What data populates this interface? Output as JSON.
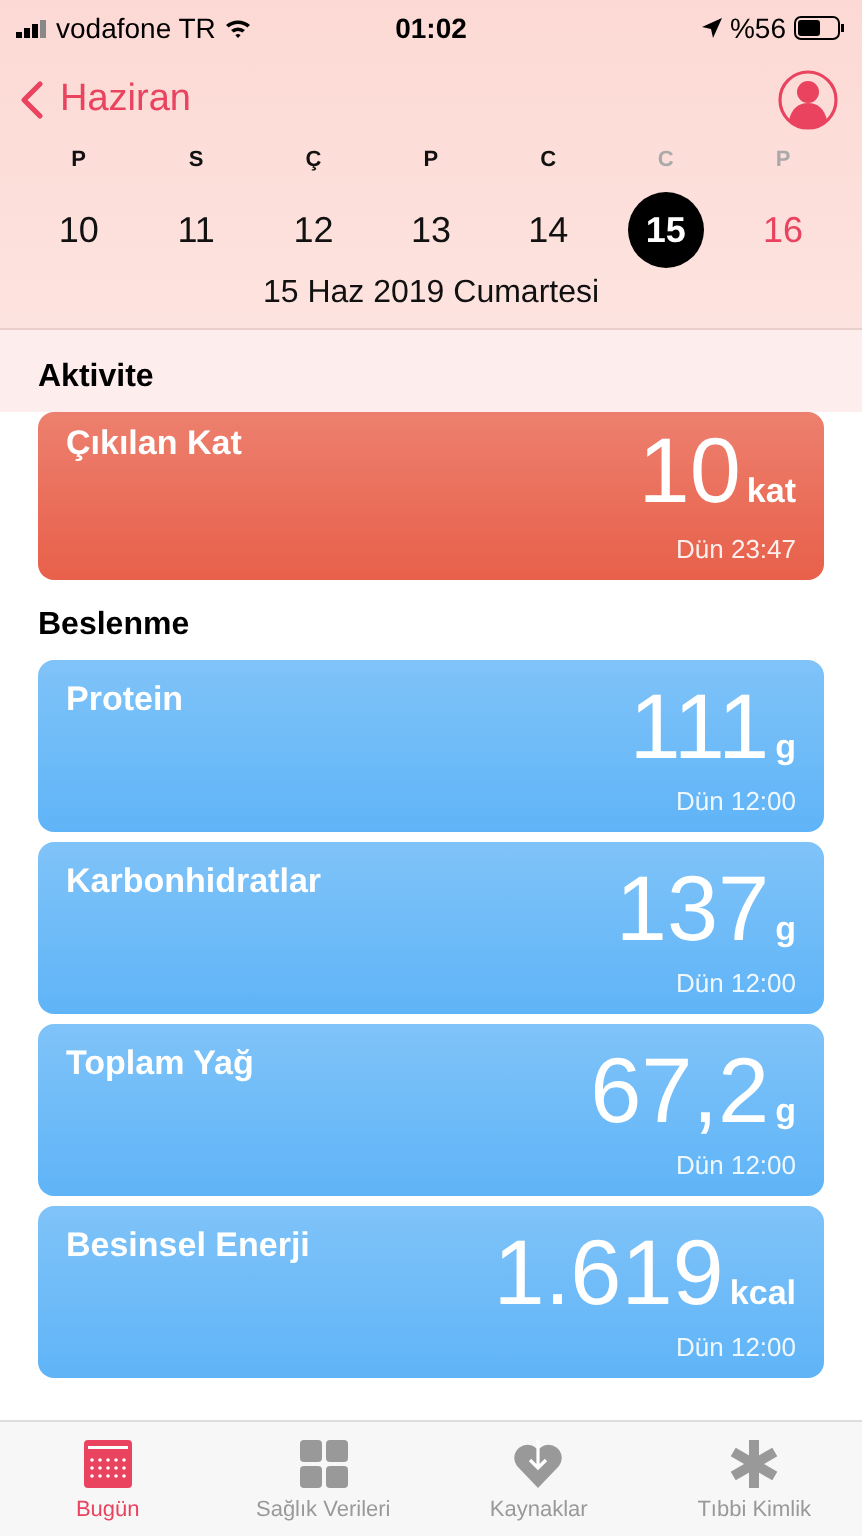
{
  "status_bar": {
    "carrier": "vodafone TR",
    "time": "01:02",
    "battery": "%56"
  },
  "nav": {
    "back": "Haziran"
  },
  "week": [
    {
      "letter": "P",
      "date": "10",
      "weekend": false,
      "today": false,
      "selected": false
    },
    {
      "letter": "S",
      "date": "11",
      "weekend": false,
      "today": false,
      "selected": false
    },
    {
      "letter": "Ç",
      "date": "12",
      "weekend": false,
      "today": false,
      "selected": false
    },
    {
      "letter": "P",
      "date": "13",
      "weekend": false,
      "today": false,
      "selected": false
    },
    {
      "letter": "C",
      "date": "14",
      "weekend": false,
      "today": false,
      "selected": false
    },
    {
      "letter": "C",
      "date": "15",
      "weekend": true,
      "today": false,
      "selected": true
    },
    {
      "letter": "P",
      "date": "16",
      "weekend": true,
      "today": true,
      "selected": false
    }
  ],
  "date_label": "15 Haz 2019 Cumartesi",
  "sections": [
    {
      "title": "Aktivite",
      "cards": [
        {
          "name": "Çıkılan Kat",
          "value": "10",
          "unit": "kat",
          "time": "Dün 23:47",
          "color": "#e8604a"
        }
      ]
    },
    {
      "title": "Beslenme",
      "cards": [
        {
          "name": "Protein",
          "value": "111",
          "unit": "g",
          "time": "Dün 12:00",
          "color": "#5fb4f7"
        },
        {
          "name": "Karbonhidratlar",
          "value": "137",
          "unit": "g",
          "time": "Dün 12:00",
          "color": "#5fb4f7"
        },
        {
          "name": "Toplam Yağ",
          "value": "67,2",
          "unit": "g",
          "time": "Dün 12:00",
          "color": "#5fb4f7"
        },
        {
          "name": "Besinsel Enerji",
          "value": "1.619",
          "unit": "kcal",
          "time": "Dün 12:00",
          "color": "#5fb4f7"
        }
      ]
    }
  ],
  "tabs": [
    {
      "label": "Bugün",
      "kind": "calendar",
      "selected": true
    },
    {
      "label": "Sağlık Verileri",
      "kind": "grid",
      "selected": false
    },
    {
      "label": "Kaynaklar",
      "kind": "heart",
      "selected": false
    },
    {
      "label": "Tıbbi Kimlik",
      "kind": "asterisk",
      "selected": false
    }
  ]
}
